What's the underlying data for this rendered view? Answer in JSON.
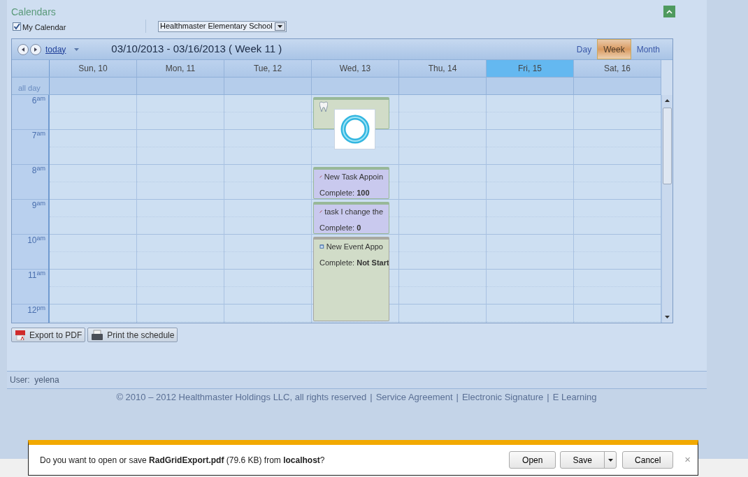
{
  "title": "Calendars",
  "my_calendar": {
    "label": "My Calendar",
    "checked": true
  },
  "school_select": {
    "value": "Healthmaster Elementary School"
  },
  "toolbar": {
    "today": "today",
    "range": "03/10/2013 - 03/16/2013 ( Week 11 )",
    "views": [
      {
        "label": "Day",
        "selected": false
      },
      {
        "label": "Week",
        "selected": true
      },
      {
        "label": "Month",
        "selected": false
      }
    ]
  },
  "days": [
    {
      "label": "Sun, 10",
      "selected": false
    },
    {
      "label": "Mon, 11",
      "selected": false
    },
    {
      "label": "Tue, 12",
      "selected": false
    },
    {
      "label": "Wed, 13",
      "selected": false
    },
    {
      "label": "Thu, 14",
      "selected": false
    },
    {
      "label": "Fri, 15",
      "selected": true
    },
    {
      "label": "Sat, 16",
      "selected": false
    }
  ],
  "all_day": "all day",
  "hours": [
    {
      "hour": "6",
      "suffix": "am"
    },
    {
      "hour": "7",
      "suffix": "am"
    },
    {
      "hour": "8",
      "suffix": "am"
    },
    {
      "hour": "9",
      "suffix": "am"
    },
    {
      "hour": "10",
      "suffix": "am"
    },
    {
      "hour": "11",
      "suffix": "am"
    },
    {
      "hour": "12",
      "suffix": "pm"
    }
  ],
  "appointments": [
    {
      "kind": "tooth"
    },
    {
      "kind": "task",
      "title": "New Task Appoin",
      "complete_label": "Complete:",
      "complete_value": "100"
    },
    {
      "kind": "task",
      "title": "task I change the",
      "complete_label": "Complete:",
      "complete_value": "0"
    },
    {
      "kind": "event",
      "title": "New Event Appo",
      "complete_label": "Complete:",
      "complete_value": "Not Start"
    }
  ],
  "loading": true,
  "buttons": [
    {
      "kind": "pdf",
      "label": "Export to PDF"
    },
    {
      "kind": "print",
      "label": "Print the schedule"
    }
  ],
  "user": "User:  yelena",
  "footer": {
    "copyright": "© 2010 – 2012 Healthmaster Holdings LLC, all rights reserved",
    "separator": "|",
    "links": [
      "Service Agreement",
      "Electronic Signature",
      "E Learning"
    ]
  },
  "download_bar": {
    "message": "Do you want to open or save **RadGridExport.pdf** (79.6 KB) from **localhost**?",
    "open": "Open",
    "save": "Save",
    "cancel": "Cancel",
    "close": "×"
  }
}
